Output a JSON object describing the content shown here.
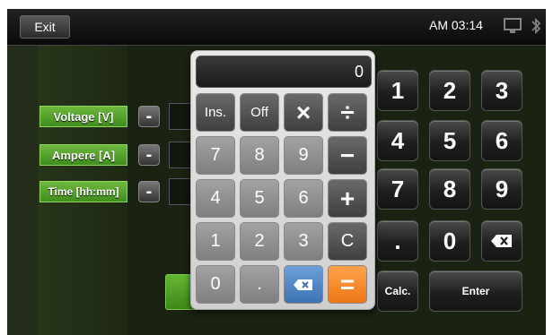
{
  "header": {
    "exit_label": "Exit",
    "clock": "AM 03:14",
    "icons": [
      "monitor-icon",
      "bluetooth-icon"
    ]
  },
  "fields": [
    {
      "label": "Voltage [V]"
    },
    {
      "label": "Ampere [A]"
    },
    {
      "label": "Time [hh:mm]"
    }
  ],
  "minus_label": "-",
  "keypad": {
    "rows": [
      [
        "1",
        "2",
        "3"
      ],
      [
        "4",
        "5",
        "6"
      ],
      [
        "7",
        "8",
        "9"
      ]
    ],
    "dot": ".",
    "zero": "0",
    "calc_label": "Calc.",
    "enter_label": "Enter"
  },
  "calculator": {
    "display": "0",
    "rows": [
      [
        "Ins.",
        "Off",
        "×",
        "÷"
      ],
      [
        "7",
        "8",
        "9",
        "−"
      ],
      [
        "4",
        "5",
        "6",
        "+"
      ],
      [
        "1",
        "2",
        "3",
        "C"
      ],
      [
        "0",
        ".",
        "",
        "="
      ]
    ]
  }
}
